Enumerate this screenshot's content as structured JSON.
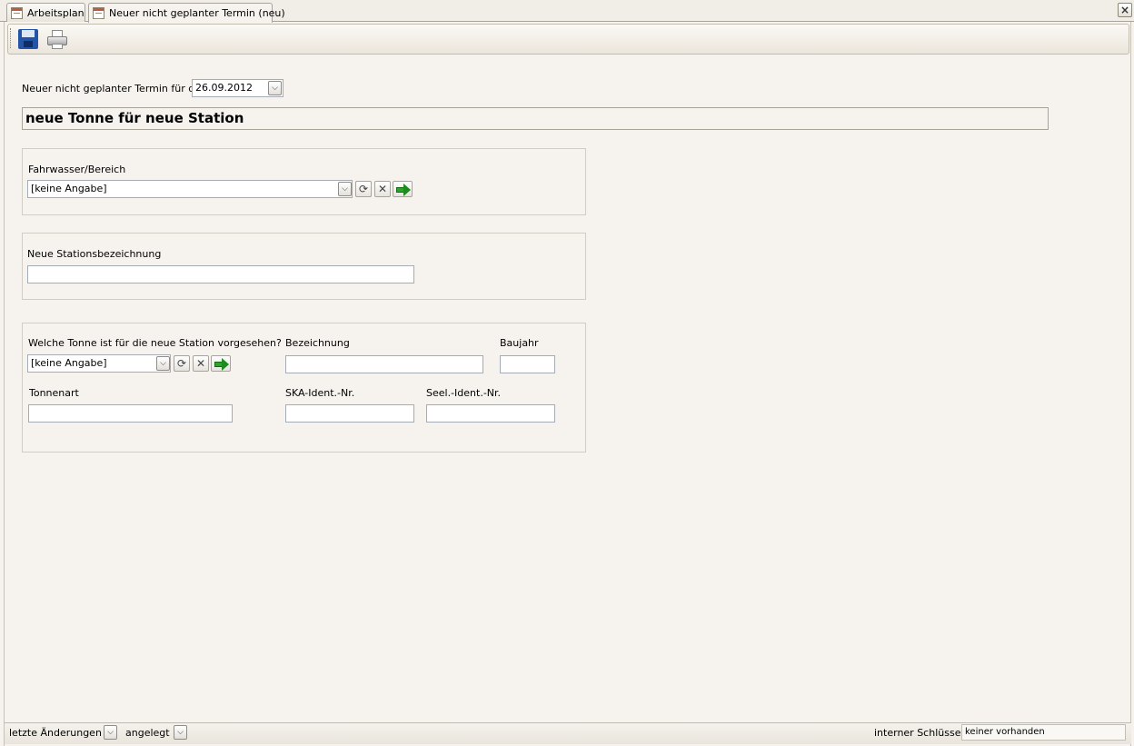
{
  "tabs": [
    {
      "label": "Arbeitsplan",
      "active": false
    },
    {
      "label": "Neuer nicht geplanter Termin (neu)",
      "active": true
    }
  ],
  "window": {
    "close_glyph": "×"
  },
  "toolbar": {
    "save_icon": "save-icon",
    "print_icon": "print-icon"
  },
  "form": {
    "date_label": "Neuer nicht geplanter Termin für den",
    "date_value": "26.09.2012",
    "heading": "neue Tonne für neue Station",
    "fahrwasser": {
      "label": "Fahrwasser/Bereich",
      "value": "[keine Angabe]"
    },
    "station": {
      "label": "Neue Stationsbezeichnung",
      "value": ""
    },
    "tonne": {
      "question_label": "Welche Tonne ist für die neue Station vorgesehen?",
      "question_value": "[keine Angabe]",
      "bezeichnung_label": "Bezeichnung",
      "bezeichnung_value": "",
      "baujahr_label": "Baujahr",
      "baujahr_value": "",
      "tonnenart_label": "Tonnenart",
      "tonnenart_value": "",
      "ska_label": "SKA-Ident.-Nr.",
      "ska_value": "",
      "seel_label": "Seel.-Ident.-Nr.",
      "seel_value": ""
    }
  },
  "statusbar": {
    "letzte_label": "letzte Änderungen",
    "angelegt_label": "angelegt",
    "schluessel_label": "interner Schlüssel",
    "schluessel_value": "keiner vorhanden"
  },
  "glyphs": {
    "dropdown": "⌵",
    "refresh": "⟳",
    "clear": "✕"
  }
}
